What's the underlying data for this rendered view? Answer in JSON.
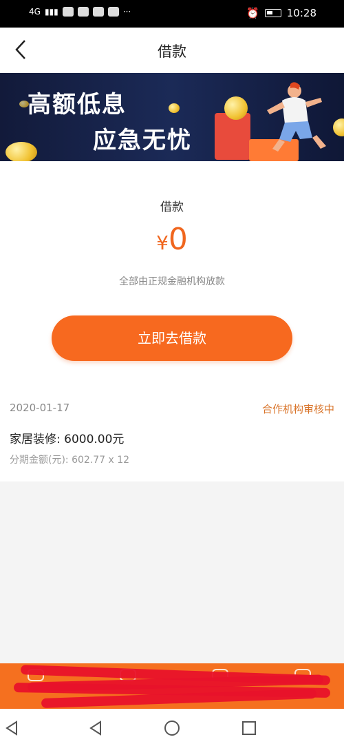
{
  "status_bar": {
    "signal_text": "4G",
    "time": "10:28"
  },
  "header": {
    "title": "借款"
  },
  "banner": {
    "line1": "高额低息",
    "line2": "应急无忧"
  },
  "loan": {
    "label": "借款",
    "currency": "¥",
    "amount": "0",
    "disclaimer": "全部由正规金融机构放款",
    "button_label": "立即去借款"
  },
  "record": {
    "date": "2020-01-17",
    "status": "合作机构审核中",
    "title": "家居装修: 6000.00元",
    "detail": "分期金额(元): 602.77 x 12"
  },
  "colors": {
    "accent": "#f7691f",
    "status": "#d9742a"
  }
}
